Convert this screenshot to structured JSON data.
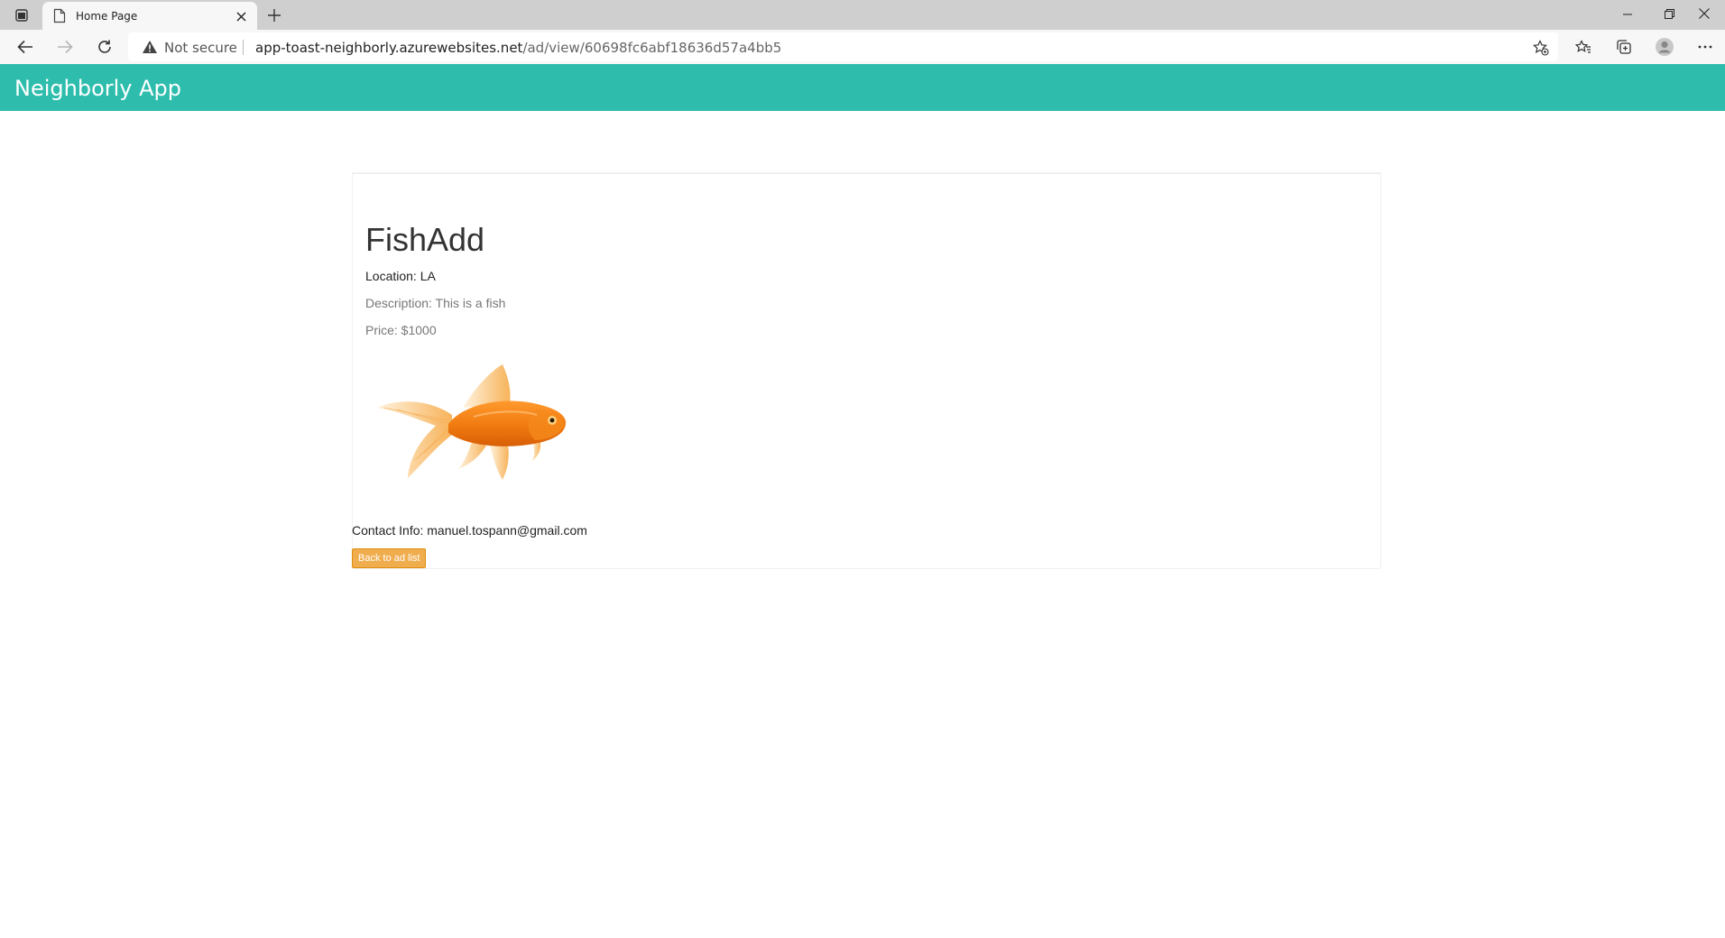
{
  "browser": {
    "tab_title": "Home Page",
    "security_label": "Not secure",
    "url_host": "app-toast-neighborly.azurewebsites.net",
    "url_path": "/ad/view/60698fc6abf18636d57a4bb5"
  },
  "navbar": {
    "brand": "Neighborly App"
  },
  "ad": {
    "title": "FishAdd",
    "location": "Location: LA",
    "description": "Description: This is a fish",
    "price": "Price: $1000",
    "image_icon": "goldfish-image",
    "contact": "Contact Info: manuel.tospann@gmail.com",
    "back_label": "Back to ad list"
  },
  "colors": {
    "navbar_bg": "#2ebdad",
    "button_bg": "#f0ad4e",
    "tabstrip_bg": "#cfcfcf"
  }
}
